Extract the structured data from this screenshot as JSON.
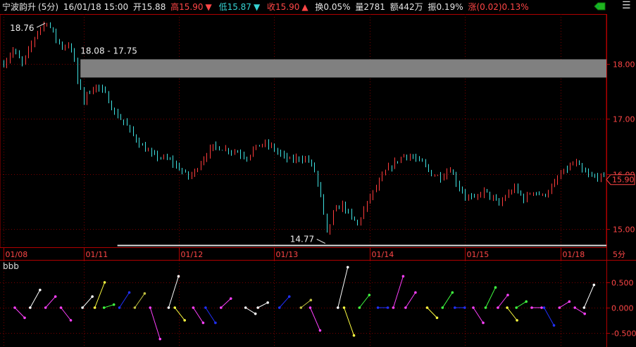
{
  "header": {
    "name": "宁波韵升",
    "period": "(5分)",
    "datetime": "16/01/18 15:00",
    "open": "开15.88",
    "high": "高15.90",
    "high_arrow": "▼",
    "low": "低15.87",
    "low_arrow": "▼",
    "close": "收15.90",
    "close_arrow": "▲",
    "turnover": "换0.05%",
    "volume": "量2781",
    "amount": "额442万",
    "amplitude": "振0.19%",
    "change": "涨(0.02)0.13%"
  },
  "indicator": {
    "title": "bbb"
  },
  "period_tag": "5分",
  "colors": {
    "up": "#ff3c3c",
    "down": "#3ee0e0",
    "grid": "#7a0000",
    "axis": "#b00000",
    "gray_band": "#808080"
  },
  "chart_data": [
    {
      "type": "candlestick",
      "title": "",
      "x_ticks": [
        "01/08",
        "01/11",
        "01/12",
        "01/13",
        "01/14",
        "01/15",
        "01/18"
      ],
      "y_ticks": [
        "18.00",
        "17.00",
        "16.00",
        "15.00"
      ],
      "ylim": [
        14.7,
        18.9
      ],
      "last_price": "15.90",
      "annotations": {
        "max_label": "18.76",
        "min_label": "14.77",
        "gap_label": "18.08 - 17.75"
      },
      "gap_zone": [
        17.75,
        18.08
      ],
      "path": [
        [
          0,
          18.0
        ],
        [
          3,
          18.25
        ],
        [
          6,
          18.0
        ],
        [
          9,
          18.35
        ],
        [
          11,
          18.6
        ],
        [
          14,
          18.76
        ],
        [
          17,
          18.45
        ],
        [
          19,
          18.3
        ],
        [
          21,
          18.35
        ],
        [
          23,
          18.08
        ],
        [
          25,
          17.2
        ],
        [
          27,
          17.45
        ],
        [
          30,
          17.6
        ],
        [
          33,
          17.45
        ],
        [
          36,
          17.1
        ],
        [
          39,
          16.95
        ],
        [
          42,
          16.7
        ],
        [
          45,
          16.5
        ],
        [
          48,
          16.35
        ],
        [
          51,
          16.3
        ],
        [
          54,
          16.25
        ],
        [
          57,
          16.1
        ],
        [
          60,
          15.95
        ],
        [
          62,
          16.05
        ],
        [
          65,
          16.3
        ],
        [
          68,
          16.5
        ],
        [
          72,
          16.45
        ],
        [
          76,
          16.4
        ],
        [
          79,
          16.3
        ],
        [
          81,
          16.45
        ],
        [
          84,
          16.55
        ],
        [
          87,
          16.5
        ],
        [
          90,
          16.35
        ],
        [
          93,
          16.25
        ],
        [
          96,
          16.3
        ],
        [
          99,
          16.25
        ],
        [
          101,
          16.05
        ],
        [
          103,
          15.6
        ],
        [
          105,
          14.9
        ],
        [
          107,
          15.3
        ],
        [
          110,
          15.45
        ],
        [
          113,
          15.2
        ],
        [
          115,
          15.1
        ],
        [
          117,
          15.35
        ],
        [
          119,
          15.6
        ],
        [
          121,
          15.75
        ],
        [
          124,
          16.05
        ],
        [
          127,
          16.2
        ],
        [
          130,
          16.35
        ],
        [
          133,
          16.3
        ],
        [
          136,
          16.2
        ],
        [
          139,
          16.0
        ],
        [
          142,
          15.95
        ],
        [
          145,
          16.1
        ],
        [
          147,
          15.85
        ],
        [
          150,
          15.6
        ],
        [
          153,
          15.55
        ],
        [
          156,
          15.7
        ],
        [
          159,
          15.55
        ],
        [
          161,
          15.45
        ],
        [
          163,
          15.6
        ],
        [
          166,
          15.75
        ],
        [
          169,
          15.55
        ],
        [
          172,
          15.7
        ],
        [
          175,
          15.6
        ],
        [
          178,
          15.75
        ],
        [
          181,
          16.0
        ],
        [
          184,
          16.15
        ],
        [
          186,
          16.2
        ],
        [
          188,
          16.05
        ],
        [
          191,
          15.95
        ]
      ]
    },
    {
      "type": "indicator",
      "name": "bbb",
      "y_ticks": [
        "0.500",
        "0.000",
        "-0.500"
      ],
      "ylim": [
        -0.75,
        0.75
      ],
      "segments": [
        {
          "x": 0,
          "v0": 0.0,
          "v1": -0.2,
          "c": "#ff40ff"
        },
        {
          "x": 5,
          "v0": 0.0,
          "v1": 0.35,
          "c": "#ffffff"
        },
        {
          "x": 10,
          "v0": 0.0,
          "v1": 0.22,
          "c": "#ff40ff"
        },
        {
          "x": 15,
          "v0": 0.0,
          "v1": -0.25,
          "c": "#ff40ff"
        },
        {
          "x": 22,
          "v0": 0.0,
          "v1": 0.22,
          "c": "#ffffff"
        },
        {
          "x": 26,
          "v0": 0.0,
          "v1": 0.5,
          "c": "#ffff40"
        },
        {
          "x": 29,
          "v0": 0.0,
          "v1": 0.06,
          "c": "#40ff40"
        },
        {
          "x": 34,
          "v0": 0.0,
          "v1": 0.3,
          "c": "#2030ff"
        },
        {
          "x": 39,
          "v0": 0.0,
          "v1": 0.28,
          "c": "#c0c040"
        },
        {
          "x": 44,
          "v0": 0.0,
          "v1": -0.62,
          "c": "#ff40ff"
        },
        {
          "x": 50,
          "v0": 0.0,
          "v1": 0.62,
          "c": "#ffffff"
        },
        {
          "x": 52,
          "v0": 0.0,
          "v1": -0.25,
          "c": "#ffff40"
        },
        {
          "x": 58,
          "v0": 0.0,
          "v1": -0.3,
          "c": "#ff40ff"
        },
        {
          "x": 62,
          "v0": 0.0,
          "v1": -0.3,
          "c": "#2030ff"
        },
        {
          "x": 67,
          "v0": 0.0,
          "v1": 0.18,
          "c": "#ff40ff"
        },
        {
          "x": 75,
          "v0": 0.0,
          "v1": -0.12,
          "c": "#ffffff"
        },
        {
          "x": 79,
          "v0": 0.0,
          "v1": 0.1,
          "c": "#ffffff"
        },
        {
          "x": 86,
          "v0": 0.0,
          "v1": 0.22,
          "c": "#2030ff"
        },
        {
          "x": 93,
          "v0": 0.0,
          "v1": 0.15,
          "c": "#c0c040"
        },
        {
          "x": 96,
          "v0": 0.0,
          "v1": -0.45,
          "c": "#ff40ff"
        },
        {
          "x": 105,
          "v0": 0.0,
          "v1": 0.8,
          "c": "#ffffff"
        },
        {
          "x": 107,
          "v0": 0.0,
          "v1": -0.55,
          "c": "#ffff40"
        },
        {
          "x": 112,
          "v0": 0.0,
          "v1": 0.25,
          "c": "#40ff40"
        },
        {
          "x": 118,
          "v0": 0.0,
          "v1": 0.0,
          "c": "#2030ff"
        },
        {
          "x": 123,
          "v0": 0.0,
          "v1": 0.62,
          "c": "#ff40ff"
        },
        {
          "x": 127,
          "v0": 0.0,
          "v1": 0.3,
          "c": "#ff40ff"
        },
        {
          "x": 134,
          "v0": 0.0,
          "v1": -0.2,
          "c": "#ffff40"
        },
        {
          "x": 139,
          "v0": 0.0,
          "v1": 0.3,
          "c": "#40ff40"
        },
        {
          "x": 143,
          "v0": 0.0,
          "v1": 0.0,
          "c": "#2030ff"
        },
        {
          "x": 149,
          "v0": 0.0,
          "v1": -0.3,
          "c": "#ff40ff"
        },
        {
          "x": 153,
          "v0": 0.0,
          "v1": 0.4,
          "c": "#40ff40"
        },
        {
          "x": 157,
          "v0": 0.0,
          "v1": 0.25,
          "c": "#ff40ff"
        },
        {
          "x": 160,
          "v0": 0.0,
          "v1": -0.25,
          "c": "#ffff40"
        },
        {
          "x": 163,
          "v0": 0.0,
          "v1": 0.12,
          "c": "#40ff40"
        },
        {
          "x": 168,
          "v0": 0.0,
          "v1": 0.0,
          "c": "#ff40ff"
        },
        {
          "x": 172,
          "v0": 0.0,
          "v1": -0.35,
          "c": "#2030ff"
        },
        {
          "x": 177,
          "v0": 0.0,
          "v1": 0.12,
          "c": "#ff40ff"
        },
        {
          "x": 182,
          "v0": 0.0,
          "v1": -0.12,
          "c": "#ff40ff"
        },
        {
          "x": 185,
          "v0": 0.0,
          "v1": 0.45,
          "c": "#ffffff"
        }
      ]
    }
  ]
}
